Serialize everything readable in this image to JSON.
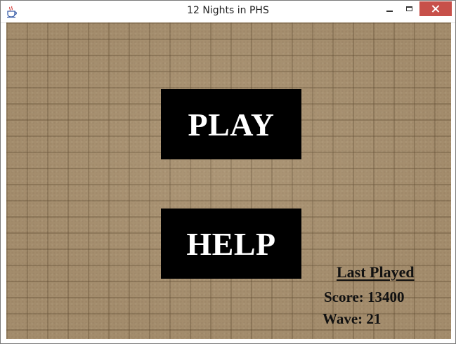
{
  "window": {
    "title": "12 Nights in PHS",
    "icon": "java-cup-icon",
    "controls": {
      "minimize_icon": "minimize-icon",
      "maximize_icon": "maximize-icon",
      "close_icon": "close-icon",
      "close_color": "#c7504a"
    }
  },
  "menu": {
    "play_label": "PLAY",
    "help_label": "HELP",
    "button_color": "#000000",
    "button_text_color": "#ffffff"
  },
  "last_played": {
    "heading": "Last Played",
    "score_label": "Score:",
    "score_value": "13400",
    "wave_label": "Wave:",
    "wave_value": "21"
  },
  "background": {
    "pattern": "sandstone-brick-tiles",
    "color": "#a38c6c"
  }
}
